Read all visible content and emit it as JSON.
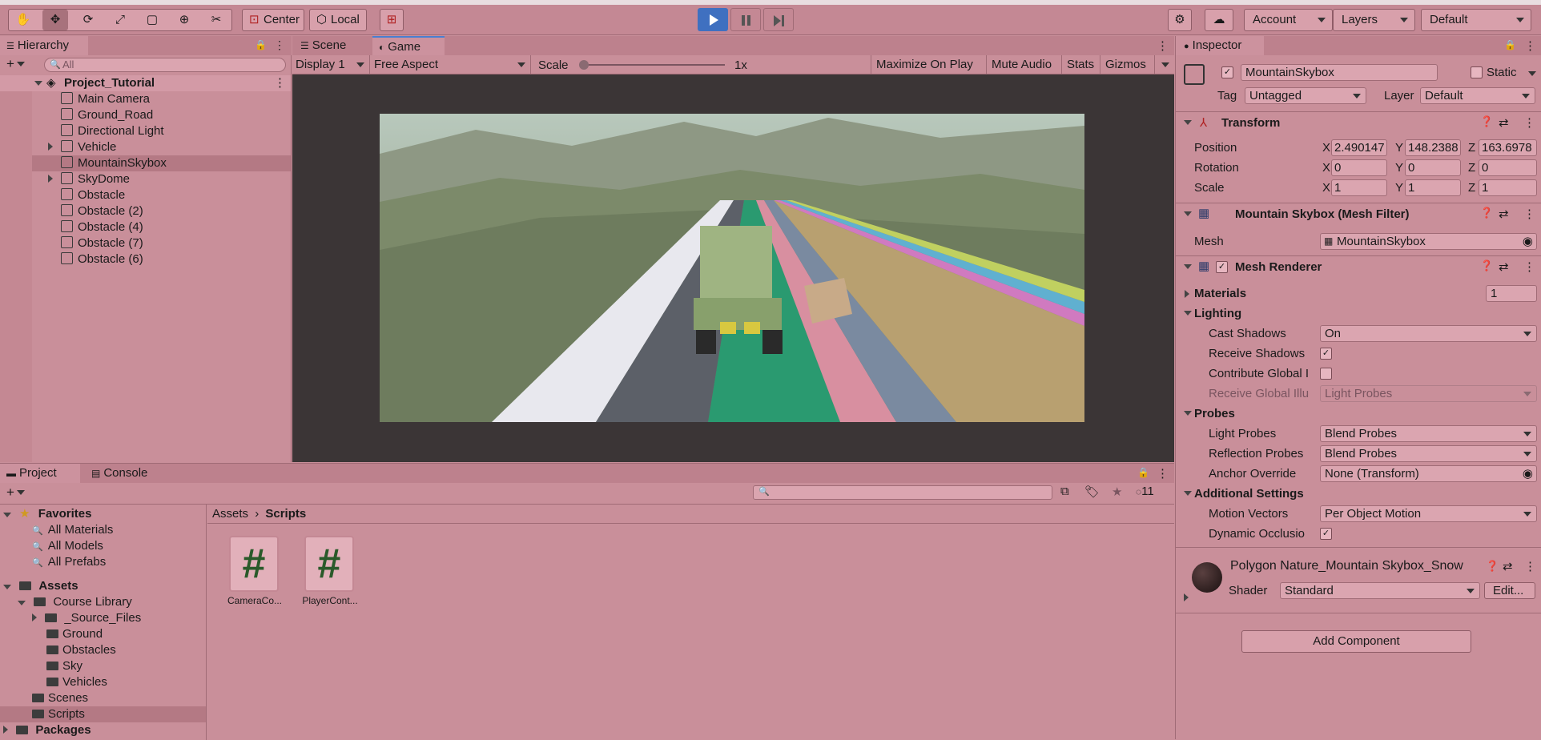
{
  "toolbar": {
    "center_label": "Center",
    "local_label": "Local",
    "account_label": "Account",
    "layers_label": "Layers",
    "layout_label": "Default"
  },
  "hierarchy": {
    "tab": "Hierarchy",
    "search_placeholder": "All",
    "scene_name": "Project_Tutorial",
    "items": [
      "Main Camera",
      "Ground_Road",
      "Directional Light",
      "Vehicle",
      "MountainSkybox",
      "SkyDome",
      "Obstacle",
      "Obstacle (2)",
      "Obstacle (4)",
      "Obstacle (7)",
      "Obstacle (6)"
    ]
  },
  "game": {
    "tab_scene": "Scene",
    "tab_game": "Game",
    "display": "Display 1",
    "aspect": "Free Aspect",
    "scale_label": "Scale",
    "scale_value": "1x",
    "maximize": "Maximize On Play",
    "mute": "Mute Audio",
    "stats": "Stats",
    "gizmos": "Gizmos"
  },
  "project": {
    "tab_project": "Project",
    "tab_console": "Console",
    "hidden_count": "11",
    "favorites": "Favorites",
    "fav_items": [
      "All Materials",
      "All Models",
      "All Prefabs"
    ],
    "assets": "Assets",
    "course_library": "Course Library",
    "course_items": [
      "_Source_Files",
      "Ground",
      "Obstacles",
      "Sky",
      "Vehicles"
    ],
    "scenes": "Scenes",
    "scripts": "Scripts",
    "packages": "Packages",
    "breadcrumb_root": "Assets",
    "breadcrumb_current": "Scripts",
    "files": [
      "CameraCo...",
      "PlayerCont..."
    ],
    "file_glyph": "#"
  },
  "inspector": {
    "tab": "Inspector",
    "object_name": "MountainSkybox",
    "static_label": "Static",
    "tag_label": "Tag",
    "tag_value": "Untagged",
    "layer_label": "Layer",
    "layer_value": "Default",
    "transform": {
      "title": "Transform",
      "position_label": "Position",
      "rotation_label": "Rotation",
      "scale_label": "Scale",
      "position": [
        "2.490147",
        "148.2388",
        "163.6978"
      ],
      "rotation": [
        "0",
        "0",
        "0"
      ],
      "scale": [
        "1",
        "1",
        "1"
      ],
      "axis_x": "X",
      "axis_y": "Y",
      "axis_z": "Z"
    },
    "mesh_filter": {
      "title": "Mountain Skybox (Mesh Filter)",
      "mesh_label": "Mesh",
      "mesh_value": "MountainSkybox"
    },
    "mesh_renderer": {
      "title": "Mesh Renderer",
      "materials_label": "Materials",
      "materials_count": "1",
      "lighting_label": "Lighting",
      "cast_shadows_label": "Cast Shadows",
      "cast_shadows_value": "On",
      "receive_shadows_label": "Receive Shadows",
      "contribute_gi_label": "Contribute Global I",
      "receive_gi_label": "Receive Global Illu",
      "receive_gi_value": "Light Probes",
      "probes_label": "Probes",
      "light_probes_label": "Light Probes",
      "light_probes_value": "Blend Probes",
      "reflection_probes_label": "Reflection Probes",
      "reflection_probes_value": "Blend Probes",
      "anchor_override_label": "Anchor Override",
      "anchor_override_value": "None (Transform)",
      "additional_label": "Additional Settings",
      "motion_vectors_label": "Motion Vectors",
      "motion_vectors_value": "Per Object Motion",
      "dynamic_occlusion_label": "Dynamic Occlusio"
    },
    "material": {
      "name": "Polygon Nature_Mountain Skybox_Snow",
      "shader_label": "Shader",
      "shader_value": "Standard",
      "edit_label": "Edit..."
    },
    "add_component": "Add Component"
  }
}
